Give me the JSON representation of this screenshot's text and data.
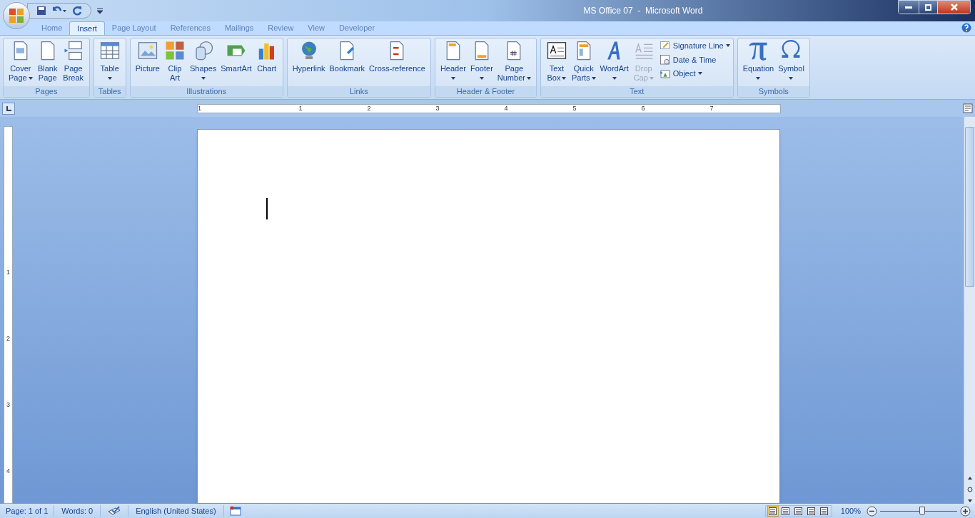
{
  "window": {
    "title": "MS Office 07  -  Microsoft Word"
  },
  "tabs": [
    {
      "label": "Home",
      "selected": false
    },
    {
      "label": "Insert",
      "selected": true
    },
    {
      "label": "Page Layout",
      "selected": false
    },
    {
      "label": "References",
      "selected": false
    },
    {
      "label": "Mailings",
      "selected": false
    },
    {
      "label": "Review",
      "selected": false
    },
    {
      "label": "View",
      "selected": false
    },
    {
      "label": "Developer",
      "selected": false
    }
  ],
  "ribbon": [
    {
      "label": "Pages",
      "items": [
        {
          "kind": "large",
          "lines": [
            "Cover",
            "Page"
          ],
          "dropdown": true,
          "disabled": false
        },
        {
          "kind": "large",
          "lines": [
            "Blank",
            "Page"
          ],
          "dropdown": false,
          "disabled": false
        },
        {
          "kind": "large",
          "lines": [
            "Page",
            "Break"
          ],
          "dropdown": false,
          "disabled": false
        }
      ]
    },
    {
      "label": "Tables",
      "items": [
        {
          "kind": "large",
          "lines": [
            "Table"
          ],
          "dropdown": true,
          "disabled": false
        }
      ]
    },
    {
      "label": "Illustrations",
      "items": [
        {
          "kind": "large",
          "lines": [
            "Picture"
          ],
          "dropdown": false,
          "disabled": false
        },
        {
          "kind": "large",
          "lines": [
            "Clip",
            "Art"
          ],
          "dropdown": false,
          "disabled": false
        },
        {
          "kind": "large",
          "lines": [
            "Shapes"
          ],
          "dropdown": true,
          "disabled": false
        },
        {
          "kind": "large",
          "lines": [
            "SmartArt"
          ],
          "dropdown": false,
          "disabled": false
        },
        {
          "kind": "large",
          "lines": [
            "Chart"
          ],
          "dropdown": false,
          "disabled": false
        }
      ]
    },
    {
      "label": "Links",
      "items": [
        {
          "kind": "large",
          "lines": [
            "Hyperlink"
          ],
          "dropdown": false,
          "disabled": false
        },
        {
          "kind": "large",
          "lines": [
            "Bookmark"
          ],
          "dropdown": false,
          "disabled": false
        },
        {
          "kind": "large",
          "lines": [
            "Cross-reference"
          ],
          "dropdown": false,
          "disabled": false
        }
      ]
    },
    {
      "label": "Header & Footer",
      "items": [
        {
          "kind": "large",
          "lines": [
            "Header"
          ],
          "dropdown": true,
          "disabled": false
        },
        {
          "kind": "large",
          "lines": [
            "Footer"
          ],
          "dropdown": true,
          "disabled": false
        },
        {
          "kind": "large",
          "lines": [
            "Page",
            "Number"
          ],
          "dropdown": true,
          "disabled": false
        }
      ]
    },
    {
      "label": "Text",
      "items": [
        {
          "kind": "large",
          "lines": [
            "Text",
            "Box"
          ],
          "dropdown": true,
          "disabled": false
        },
        {
          "kind": "large",
          "lines": [
            "Quick",
            "Parts"
          ],
          "dropdown": true,
          "disabled": false
        },
        {
          "kind": "large",
          "lines": [
            "WordArt"
          ],
          "dropdown": true,
          "disabled": false
        },
        {
          "kind": "large",
          "lines": [
            "Drop",
            "Cap"
          ],
          "dropdown": true,
          "disabled": true
        },
        {
          "kind": "small",
          "lines": [
            "Signature Line"
          ],
          "dropdown": true,
          "disabled": false
        },
        {
          "kind": "small",
          "lines": [
            "Date & Time"
          ],
          "dropdown": false,
          "disabled": false
        },
        {
          "kind": "small",
          "lines": [
            "Object"
          ],
          "dropdown": true,
          "disabled": false
        }
      ]
    },
    {
      "label": "Symbols",
      "items": [
        {
          "kind": "large",
          "lines": [
            "Equation"
          ],
          "dropdown": true,
          "disabled": false
        },
        {
          "kind": "large",
          "lines": [
            "Symbol"
          ],
          "dropdown": true,
          "disabled": false
        }
      ]
    }
  ],
  "ruler": {
    "horizontal": [
      "1",
      "1",
      "2",
      "3",
      "4",
      "5",
      "6",
      "7"
    ],
    "vertical": [
      "1",
      "2",
      "3",
      "4"
    ]
  },
  "status_bar": {
    "page": "Page: 1 of 1",
    "words": "Words: 0",
    "language": "English (United States)",
    "zoom": "100%",
    "zoom_slider": {
      "level": 0.55
    },
    "views": [
      {
        "selected": true
      },
      {
        "selected": false
      },
      {
        "selected": false
      },
      {
        "selected": false
      },
      {
        "selected": false
      }
    ]
  }
}
